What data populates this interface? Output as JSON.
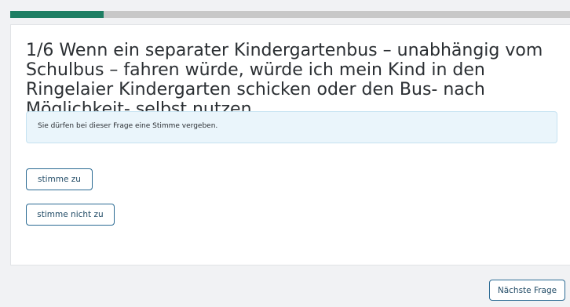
{
  "progress": {
    "fraction": 0.167,
    "fill_color": "#1e7e63",
    "track_color": "#c8c8c8"
  },
  "question": {
    "text": "1/6 Wenn ein separater Kindergartenbus – unabhängig vom Schulbus – fahren würde, würde ich mein Kind in den Ringelaier Kindergarten schicken oder den Bus- nach Möglichkeit- selbst nutzen."
  },
  "info": {
    "text": "Sie dürfen bei dieser Frage eine Stimme vergeben."
  },
  "answers": [
    {
      "label": "stimme zu"
    },
    {
      "label": "stimme nicht zu"
    }
  ],
  "navigation": {
    "next_label": "Nächste Frage"
  },
  "colors": {
    "button_border": "#2a6a93",
    "info_background": "#eaf5fb"
  }
}
